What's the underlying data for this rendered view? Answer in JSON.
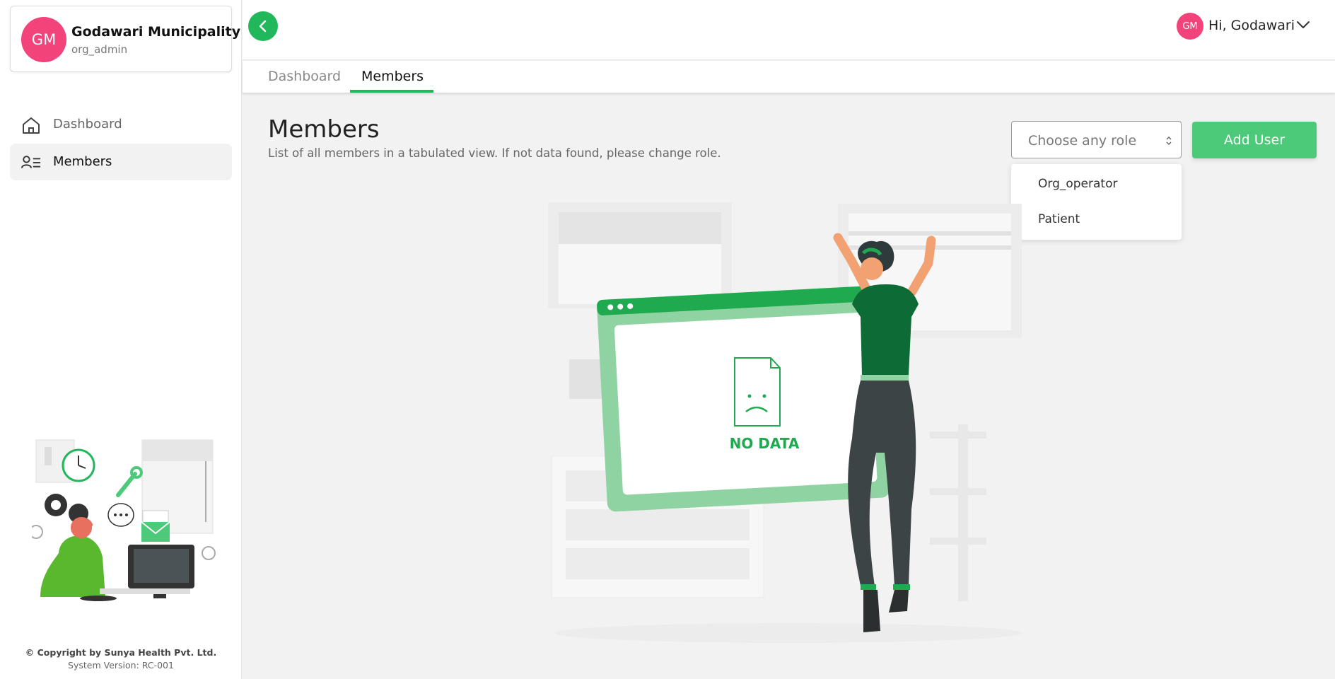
{
  "org": {
    "avatar_initials": "GM",
    "name": "Godawari Municipality",
    "role": "org_admin",
    "avatar_color": "#f2437a"
  },
  "sidebar": {
    "items": [
      {
        "label": "Dashboard",
        "icon": "home-icon",
        "active": false
      },
      {
        "label": "Members",
        "icon": "members-list-icon",
        "active": true
      }
    ],
    "copyright": "© Copyright by Sunya Health Pvt. Ltd.",
    "version": "System Version: RC-001"
  },
  "header": {
    "back_icon": "chevron-left-icon",
    "user_initials": "GM",
    "greeting": "Hi, Godawari",
    "accent": "#21b85c"
  },
  "tabs": [
    {
      "label": "Dashboard",
      "active": false
    },
    {
      "label": "Members",
      "active": true
    }
  ],
  "main": {
    "title": "Members",
    "subtitle": "List of all members in a tabulated view. If not data found, please change role.",
    "role_select": {
      "placeholder": "Choose any role",
      "options": [
        "Org_operator",
        "Patient"
      ]
    },
    "add_user_label": "Add User",
    "empty_state_text": "NO DATA"
  }
}
